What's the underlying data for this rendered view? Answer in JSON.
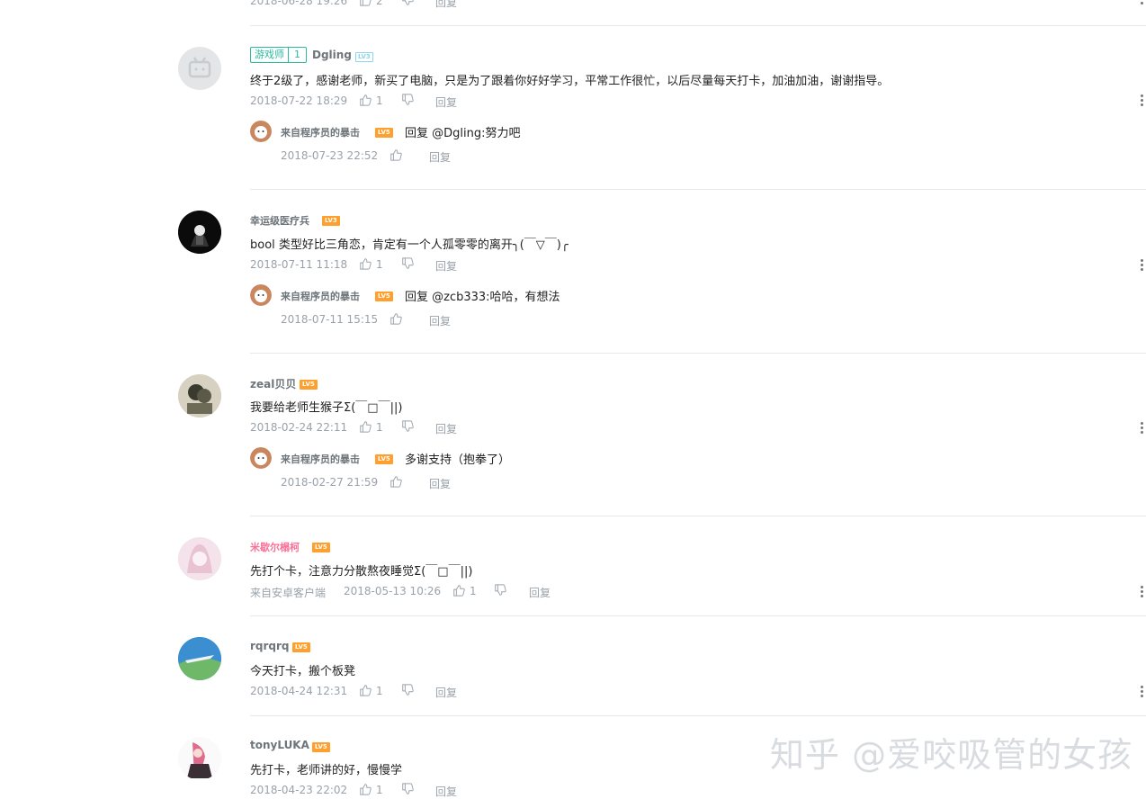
{
  "top_partial": {
    "time": "2018-06-28 19:26",
    "likes": "2",
    "reply_label": "回复"
  },
  "comments": [
    {
      "user": "Dgling",
      "badge": {
        "label": "游戏师",
        "number": "1"
      },
      "level": "LV3",
      "text": "终于2级了，感谢老师，新买了电脑，只是为了跟着你好好学习，平常工作很忙，以后尽量每天打卡，加油加油，谢谢指导。",
      "time": "2018-07-22 18:29",
      "likes": "1",
      "reply_label": "回复",
      "reply": {
        "user": "来自程序员的暴击",
        "level": "LV5",
        "text": "回复 @Dgling:努力吧",
        "time": "2018-07-23 22:52",
        "reply_label": "回复"
      }
    },
    {
      "user": "幸运级医疗兵",
      "level": "LV3",
      "text": "bool 类型好比三角恋，肯定有一个人孤零零的离开╮(￣▽￣)╭",
      "time": "2018-07-11 11:18",
      "likes": "1",
      "reply_label": "回复",
      "reply": {
        "user": "来自程序员的暴击",
        "level": "LV5",
        "text": "回复 @zcb333:哈哈，有想法",
        "time": "2018-07-11 15:15",
        "reply_label": "回复"
      }
    },
    {
      "user": "zeal贝贝",
      "level": "LV5",
      "text": "我要给老师生猴子Σ(￣□￣||)",
      "time": "2018-02-24 22:11",
      "likes": "1",
      "reply_label": "回复",
      "reply": {
        "user": "来自程序员的暴击",
        "level": "LV5",
        "text": "多谢支持（抱拳了）",
        "time": "2018-02-27 21:59",
        "reply_label": "回复"
      }
    },
    {
      "user": "米歇尔榻柯",
      "level": "LV5",
      "text": "先打个卡，注意力分散熬夜睡觉Σ(￣□￣||)",
      "source": "来自安卓客户端",
      "time": "2018-05-13 10:26",
      "likes": "1",
      "reply_label": "回复"
    },
    {
      "user": "rqrqrq",
      "level": "LV5",
      "text": "今天打卡，搬个板凳",
      "time": "2018-04-24 12:31",
      "likes": "1",
      "reply_label": "回复"
    },
    {
      "user": "tonyLUKA",
      "level": "LV5",
      "text": "先打卡，老师讲的好，慢慢学",
      "time": "2018-04-23 22:02",
      "likes": "1",
      "reply_label": "回复"
    }
  ],
  "watermark": "知乎 @爱咬吸管的女孩",
  "colors": {
    "meta_gray": "#99a2aa",
    "level_orange": "#ff9f2e",
    "level_blue": "#8bd5ed",
    "badge_green": "#2bba9d",
    "pink_name": "#fb7299",
    "separator": "#e5e9ef"
  },
  "icons": [
    "thumb-up-icon",
    "thumb-down-icon",
    "more-options-icon",
    "avatar"
  ]
}
